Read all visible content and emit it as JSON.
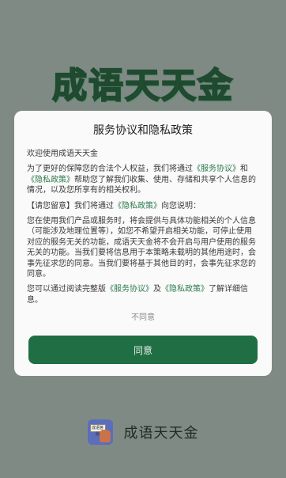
{
  "app": {
    "title": "成语天天金"
  },
  "dialog": {
    "title": "服务协议和隐私政策",
    "welcome": "欢迎使用成语天天金",
    "p1_pre": "为了更好的保障您的合法个人权益，我们将通过",
    "service_link": "《服务协议》",
    "and": "和",
    "privacy_link": "《隐私政策》",
    "p1_post": "帮助您了解我们收集、使用、存储和共享个人信息的情况，以及您所享有的相关权利。",
    "p2_pre": "【请您留意】我们将通过",
    "p2_post": "向您说明：",
    "p3": "您在使用我们产品或服务时，将会提供与具体功能相关的个人信息（可能涉及地理位置等），如您不希望开启相关功能，可停止使用对应的服务无关的功能，成语天天金将不会开启与用户使用的服务无关的功能。当我们要将信息用于本策略未载明的其他用途时，会事先征求您的同意。当我们要将基于其他目的时，会事先征求您的同意。",
    "p4_pre": "您可以通过阅读完整版",
    "p4_mid": "及",
    "p4_post": "了解详细信息。",
    "decline": "不同意",
    "agree": "同意"
  },
  "footer": {
    "logo_text": "成语答题",
    "name": "成语天天金"
  },
  "colors": {
    "brand_green": "#1f6e44",
    "link_green": "#2f7a4f",
    "backdrop": "#7f8a84"
  }
}
